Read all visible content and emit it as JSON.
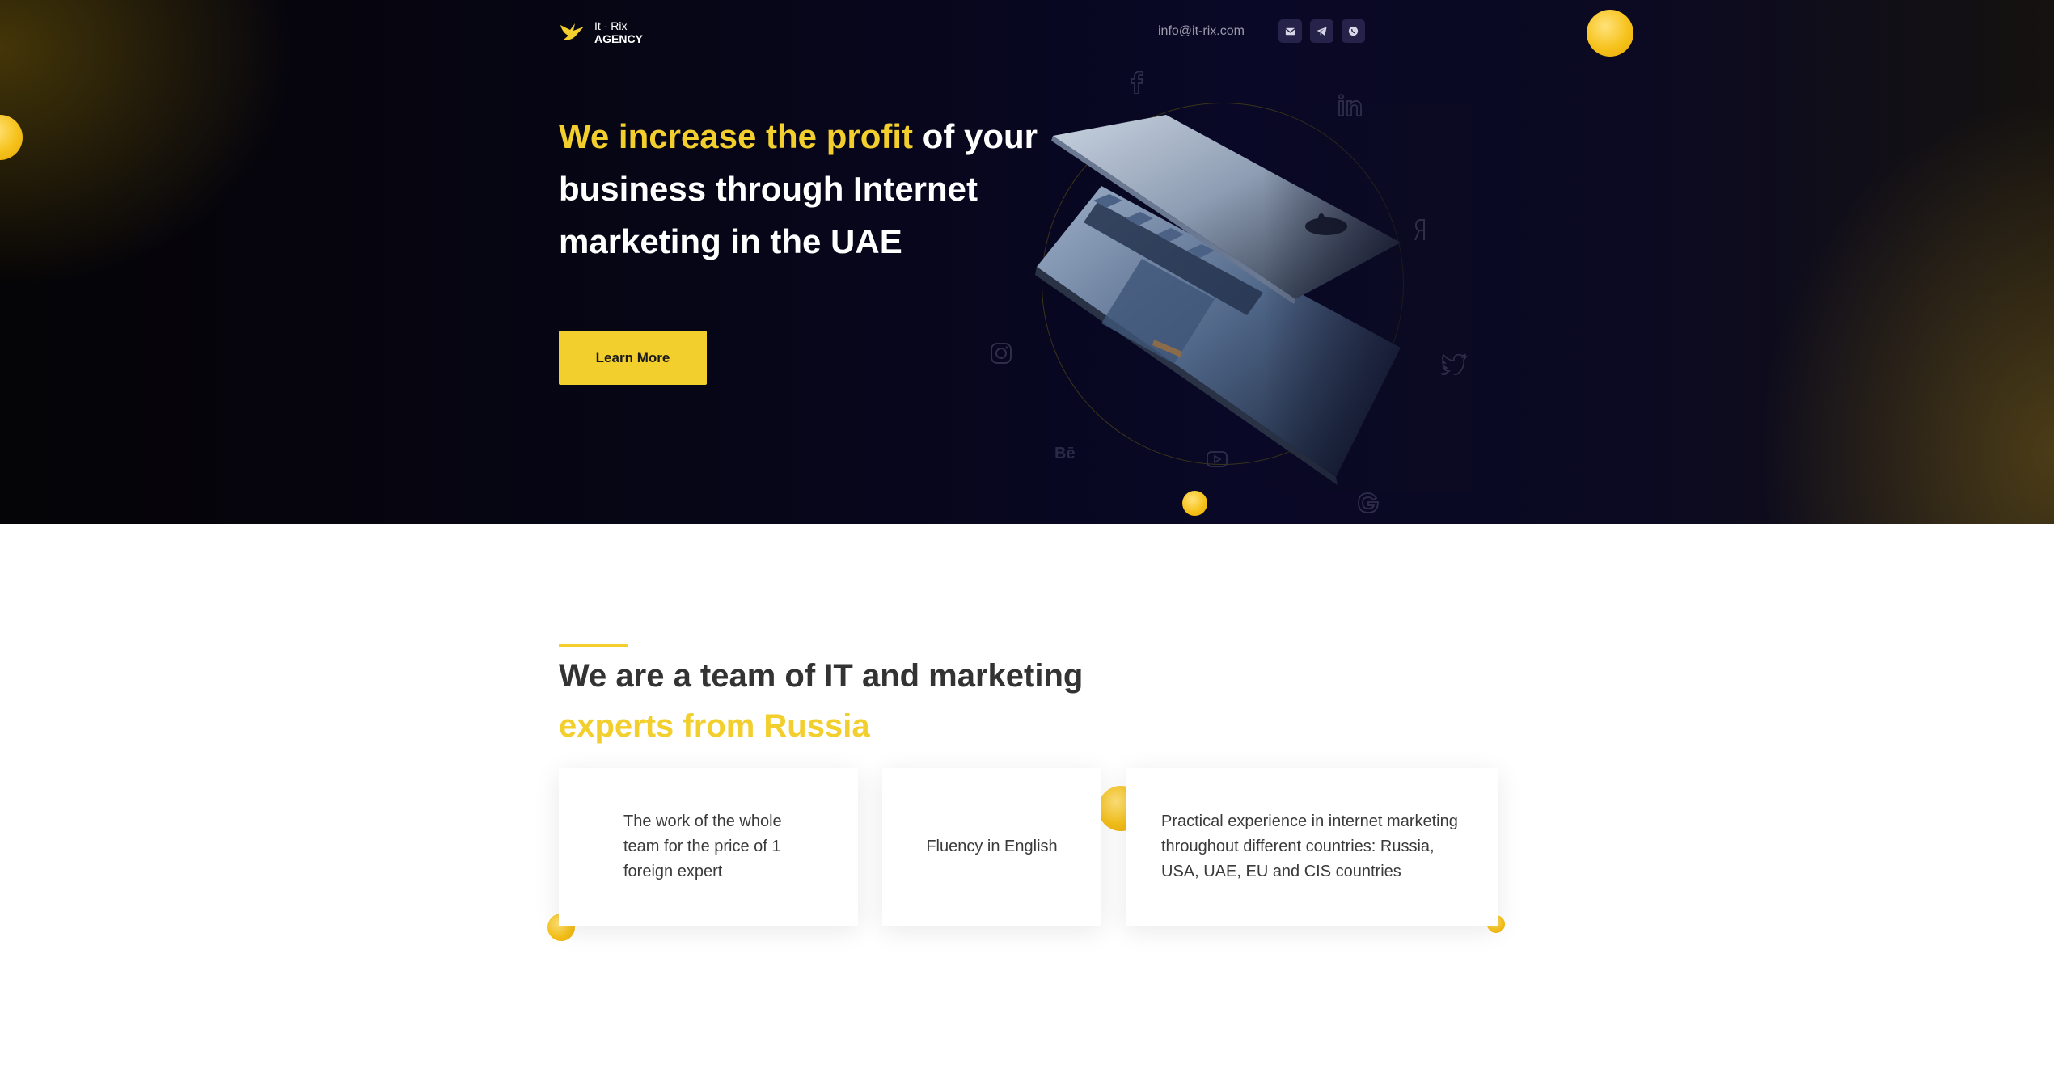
{
  "brand": {
    "line1": "It - Rix",
    "line2": "AGENCY"
  },
  "header": {
    "email": "info@it-rix.com",
    "socials": [
      "mail-icon",
      "telegram-icon",
      "whatsapp-icon"
    ]
  },
  "hero": {
    "title_highlight": "We increase the profit",
    "title_rest": " of your business through Internet marketing in the UAE",
    "cta_label": "Learn More",
    "floating_icons": [
      "facebook-icon",
      "linkedin-icon",
      "yandex-icon",
      "instagram-icon",
      "twitter-icon",
      "behance-icon",
      "youtube-icon",
      "google-icon"
    ]
  },
  "about": {
    "title_plain": "We are a team of IT and marketing ",
    "title_highlight": "experts from Russia",
    "cards": [
      "The work of the whole team for the price of 1 foreign expert",
      "Fluency in English",
      "Practical experience in internet marketing throughout different countries: Russia, USA, UAE, EU and CIS countries"
    ]
  },
  "colors": {
    "accent": "#f3cf2d",
    "hero_bg": "#07061a",
    "text_dark": "#333333"
  }
}
